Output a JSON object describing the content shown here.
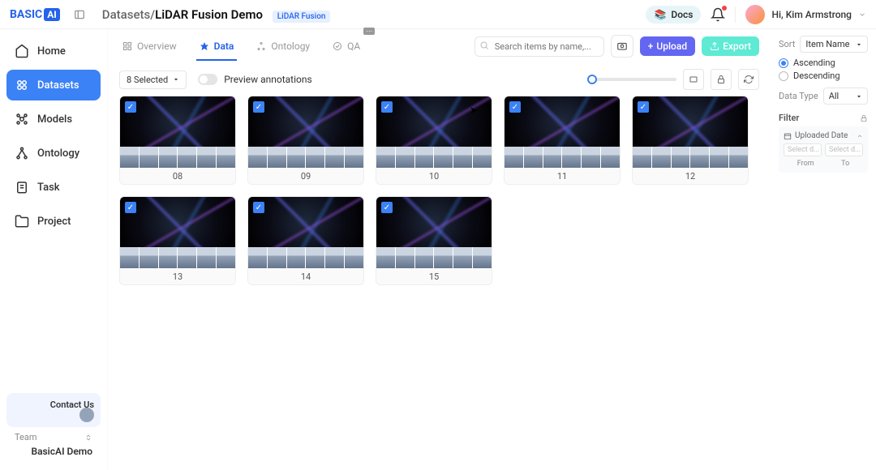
{
  "logo": {
    "part1": "BASIC",
    "part2": "AI"
  },
  "breadcrumb": {
    "parent": "Datasets",
    "sep": "/",
    "current": "LiDAR Fusion Demo",
    "tag": "LiDAR Fusion"
  },
  "docs_label": "Docs",
  "user": {
    "greeting": "Hi, Kim Armstrong"
  },
  "sidebar": {
    "items": [
      {
        "label": "Home"
      },
      {
        "label": "Datasets"
      },
      {
        "label": "Models"
      },
      {
        "label": "Ontology"
      },
      {
        "label": "Task"
      },
      {
        "label": "Project"
      }
    ],
    "contact": "Contact Us",
    "team_label": "Team",
    "team_name": "BasicAI Demo"
  },
  "tabs": {
    "overview": "Overview",
    "data": "Data",
    "ontology": "Ontology",
    "qa": "QA"
  },
  "search": {
    "placeholder": "Search items by name,..."
  },
  "buttons": {
    "upload": "Upload",
    "export": "Export"
  },
  "toolbar": {
    "selected": "8 Selected",
    "preview": "Preview annotations"
  },
  "cards": [
    {
      "label": "08"
    },
    {
      "label": "09"
    },
    {
      "label": "10"
    },
    {
      "label": "11"
    },
    {
      "label": "12"
    },
    {
      "label": "13"
    },
    {
      "label": "14"
    },
    {
      "label": "15"
    }
  ],
  "sort": {
    "label": "Sort",
    "value": "Item Name",
    "asc": "Ascending",
    "desc": "Descending",
    "datatype_label": "Data Type",
    "datatype_value": "All",
    "filter_label": "Filter",
    "uploaded_date": "Uploaded Date",
    "select_placeholder": "Select d...",
    "from": "From",
    "to": "To"
  }
}
